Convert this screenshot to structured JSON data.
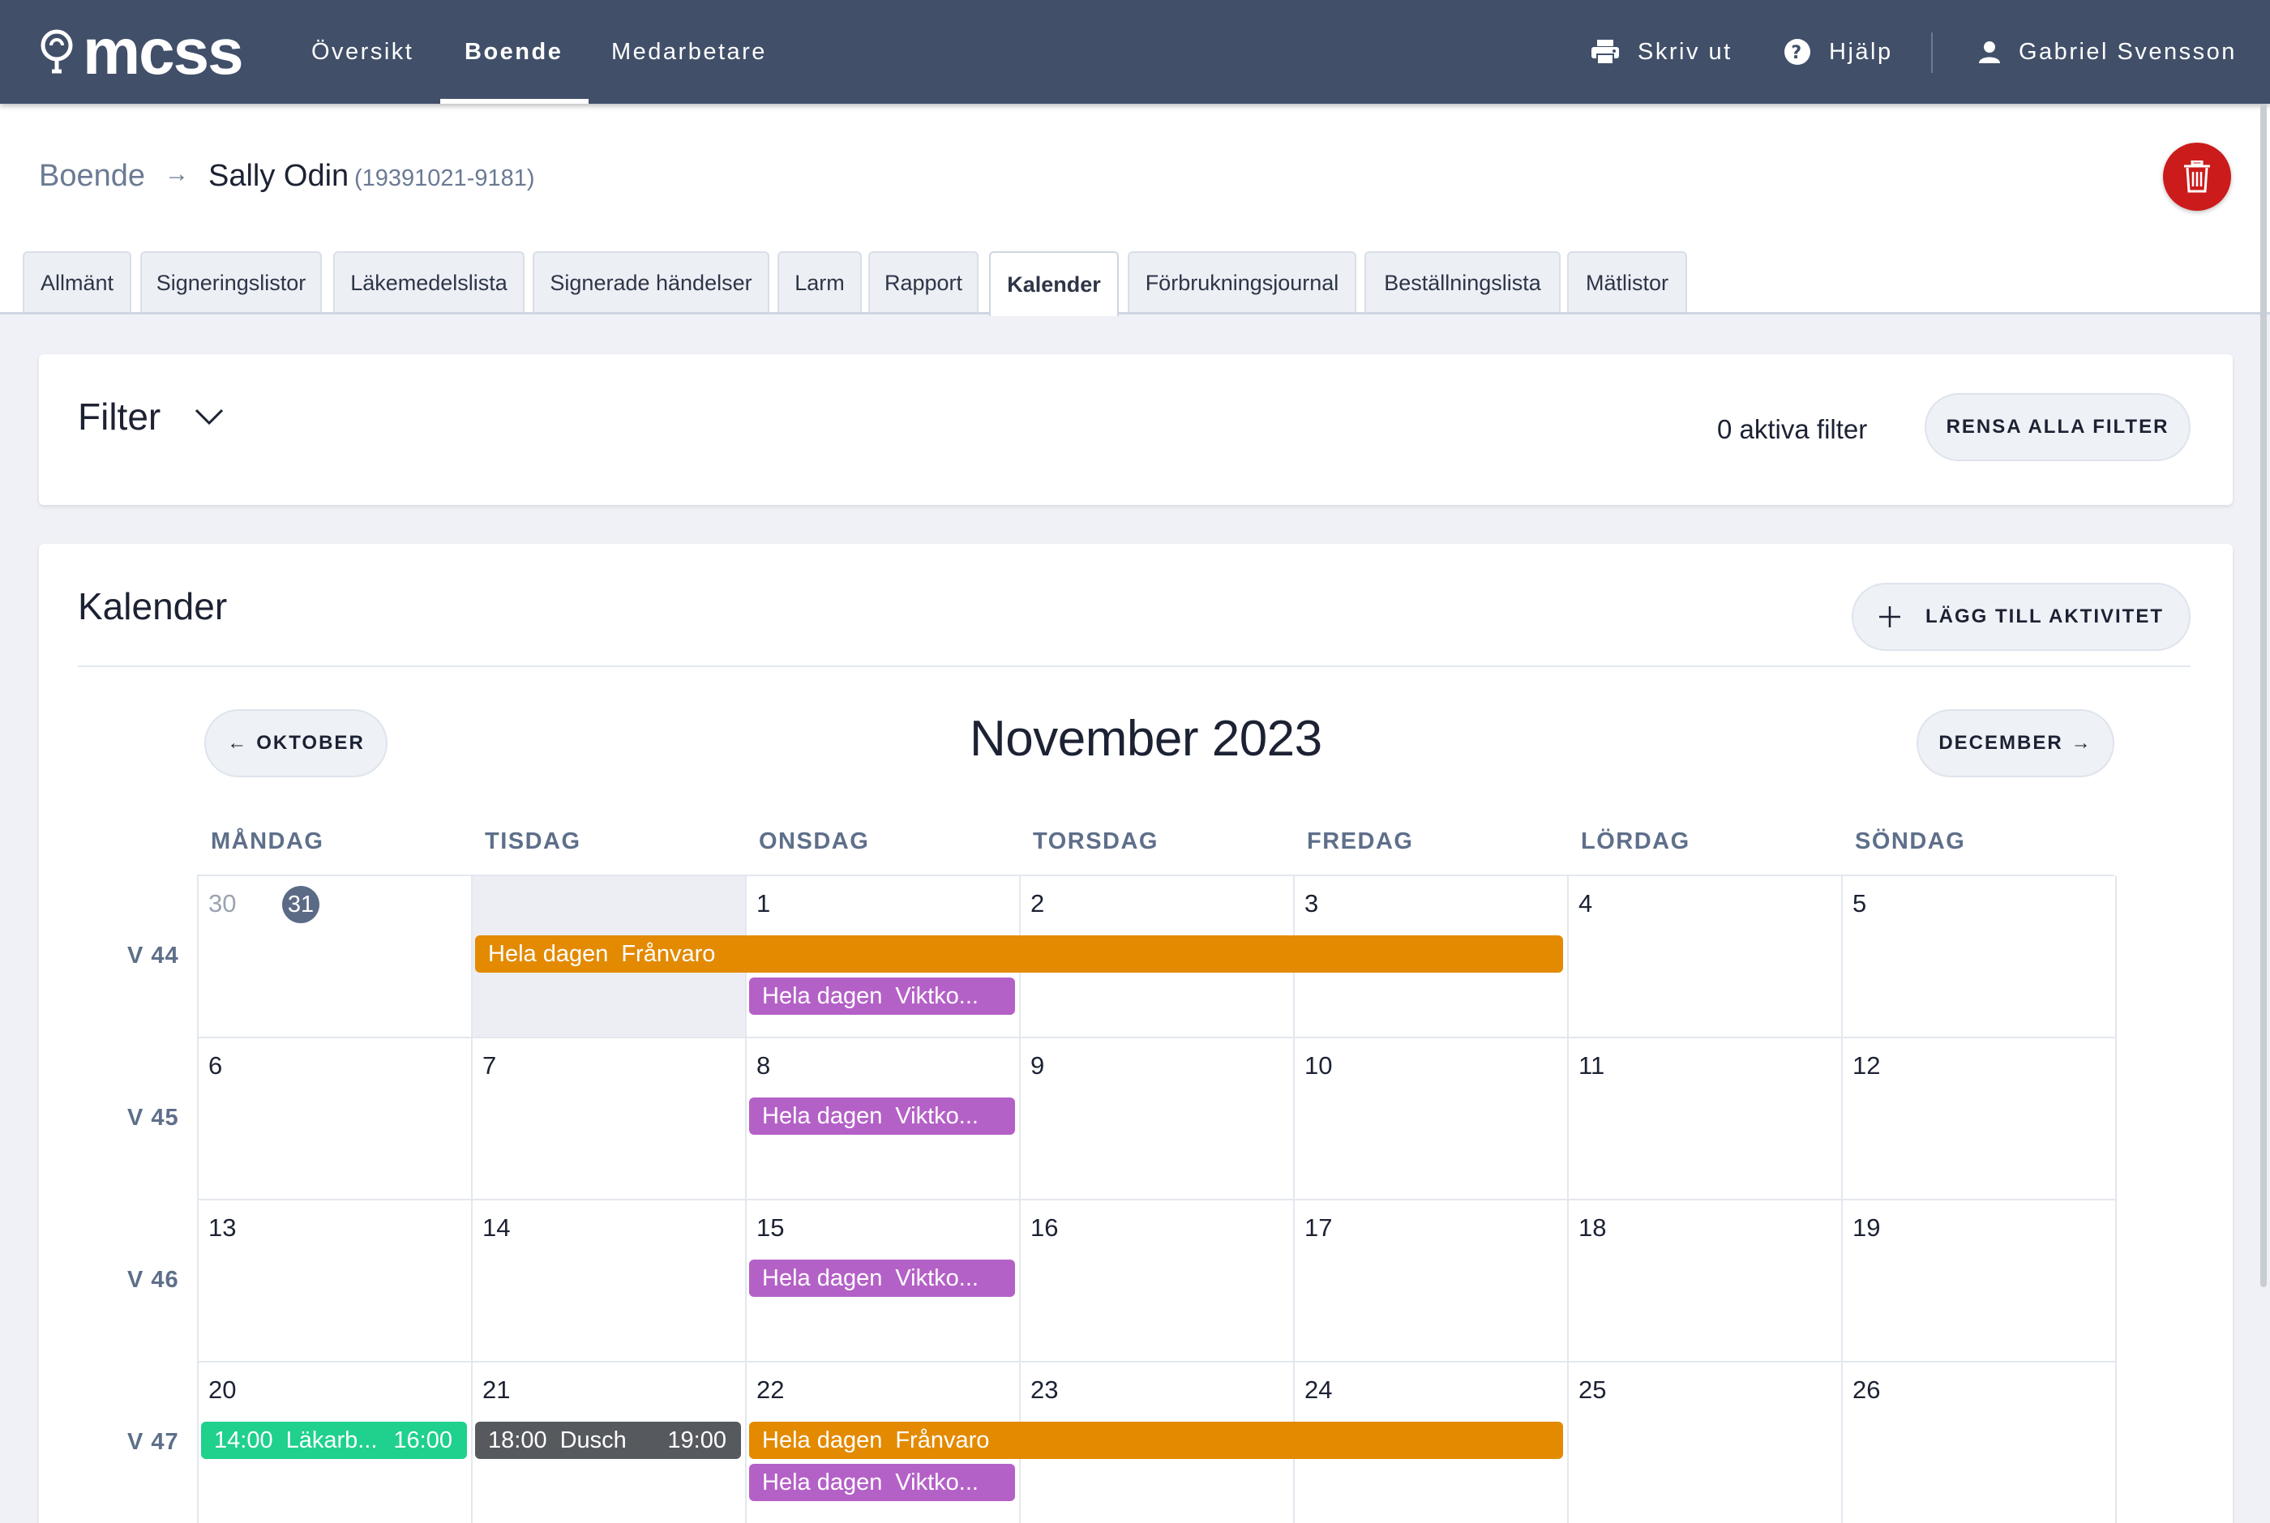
{
  "app": {
    "logo_text": "mcss",
    "nav": [
      "Översikt",
      "Boende",
      "Medarbetare"
    ],
    "actions": {
      "print": "Skriv ut",
      "help": "Hjälp",
      "user": "Gabriel Svensson"
    },
    "colors": {
      "topbar": "#414f69",
      "delete": "#cc1b1b",
      "orange": "#e38a00",
      "purple": "#b461c7",
      "green": "#1fd18c",
      "gray": "#565a5f"
    }
  },
  "breadcrumb": {
    "root": "Boende",
    "name": "Sally Odin",
    "id": "(19391021-9181)"
  },
  "tabs": [
    "Allmänt",
    "Signeringslistor",
    "Läkemedelslista",
    "Signerade händelser",
    "Larm",
    "Rapport",
    "Kalender",
    "Förbrukningsjournal",
    "Beställningslista",
    "Mätlistor"
  ],
  "active_tab": "Kalender",
  "filter": {
    "title": "Filter",
    "count": "0 aktiva filter",
    "clear": "RENSA ALLA FILTER"
  },
  "calendar": {
    "title": "Kalender",
    "add": "LÄGG TILL AKTIVITET",
    "prev": "OKTOBER",
    "next": "DECEMBER",
    "month": "November 2023",
    "weekdays": [
      "MÅNDAG",
      "TISDAG",
      "ONSDAG",
      "TORSDAG",
      "FREDAG",
      "LÖRDAG",
      "SÖNDAG"
    ],
    "weeks": [
      {
        "label": "V 44",
        "days": [
          "30",
          "31",
          "1",
          "2",
          "3",
          "4",
          "5"
        ]
      },
      {
        "label": "V 45",
        "days": [
          "6",
          "7",
          "8",
          "9",
          "10",
          "11",
          "12"
        ]
      },
      {
        "label": "V 46",
        "days": [
          "13",
          "14",
          "15",
          "16",
          "17",
          "18",
          "19"
        ]
      },
      {
        "label": "V 47",
        "days": [
          "20",
          "21",
          "22",
          "23",
          "24",
          "25",
          "26"
        ]
      }
    ],
    "today": "31",
    "events": {
      "w44_absence": {
        "start": "Hela dagen",
        "label": "Frånvaro"
      },
      "w44_weight": {
        "start": "Hela dagen",
        "label": "Viktko..."
      },
      "w45_weight": {
        "start": "Hela dagen",
        "label": "Viktko..."
      },
      "w46_weight": {
        "start": "Hela dagen",
        "label": "Viktko..."
      },
      "w47_doctor": {
        "start": "14:00",
        "label": "Läkarb...",
        "end": "16:00"
      },
      "w47_shower": {
        "start": "18:00",
        "label": "Dusch",
        "end": "19:00"
      },
      "w47_absence": {
        "start": "Hela dagen",
        "label": "Frånvaro"
      },
      "w47_weight": {
        "start": "Hela dagen",
        "label": "Viktko..."
      }
    }
  }
}
